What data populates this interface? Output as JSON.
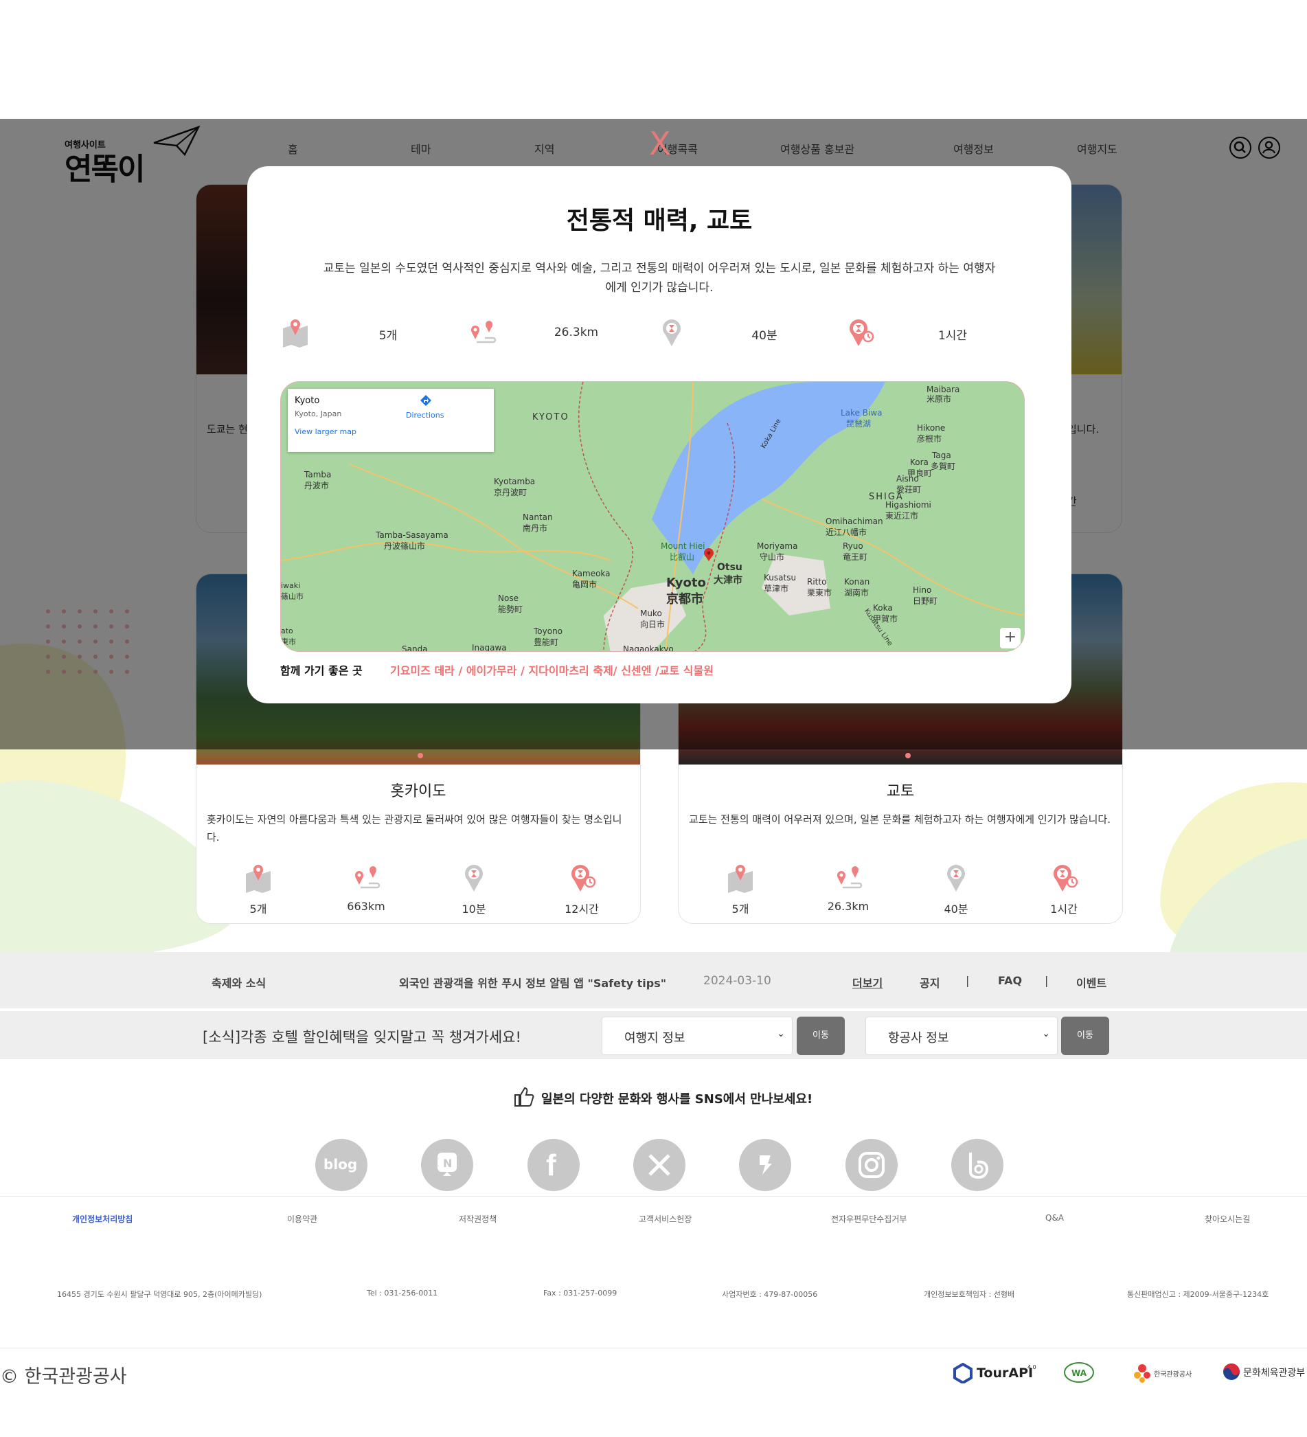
{
  "header": {
    "logo_small": "여행사이트",
    "logo_main": "연똑이",
    "nav": [
      "홈",
      "테마",
      "지역",
      "여행콕콕",
      "여행상품 홍보관",
      "여행정보",
      "여행지도"
    ]
  },
  "cards": {
    "tokyo_desc_fragment": "도쿄는 현",
    "osaka_desc_fragment": "입니다.",
    "osaka_time_fragment": "간",
    "hokkaido": {
      "title": "홋카이도",
      "desc": "홋카이도는 자연의 아름다움과 특색 있는 관광지로 둘러싸여 있어 많은 여행자들이 찾는 명소입니다.",
      "stats": [
        "5개",
        "663km",
        "10분",
        "12시간"
      ]
    },
    "kyoto": {
      "title": "교토",
      "desc": "교토는 전통의 매력이 어우러져 있으며, 일본 문화를 체험하고자 하는 여행자에게 인기가 많습니다.",
      "stats": [
        "5개",
        "26.3km",
        "40분",
        "1시간"
      ]
    }
  },
  "modal": {
    "close": "X",
    "title": "전통적 매력, 교토",
    "desc": "교토는 일본의 수도였던 역사적인 중심지로 역사와 예술, 그리고 전통의 매력이 어우러져 있는 도시로, 일본 문화를 체험하고자 하는 여행자에게 인기가 많습니다.",
    "stats": [
      "5개",
      "26.3km",
      "40분",
      "1시간"
    ],
    "map": {
      "place": "Kyoto",
      "place_sub": "Kyoto, Japan",
      "directions": "Directions",
      "larger": "View larger map",
      "labels": [
        "KYOTO",
        "Lake Biwa",
        "琵琶湖",
        "SHIGA",
        "Kyoto",
        "京都市",
        "Otsu",
        "大津市",
        "Mount Hiei",
        "比叡山",
        "Tamba",
        "丹波市",
        "Kyotamba",
        "京丹波町",
        "Nantan",
        "南丹市",
        "Tamba-Sasayama",
        "丹波篠山市",
        "Kameoka",
        "亀岡市",
        "Nose",
        "能勢町",
        "Muko",
        "向日市",
        "Toyono",
        "豊能町",
        "Moriyama",
        "守山市",
        "Ryuo",
        "竜王町",
        "Omihachiman",
        "近江八幡市",
        "Higashiomi",
        "東近江市",
        "Kusatsu",
        "草津市",
        "Ritto",
        "栗東市",
        "Konan",
        "湖南市",
        "Koka",
        "甲賀市",
        "Hino",
        "日野町",
        "Aisho",
        "愛荘町",
        "Kora",
        "甲良町",
        "Taga",
        "多賀町",
        "Hikone",
        "彦根市",
        "Maibara",
        "米原市",
        "Sanda",
        "Inagawa",
        "Nagaokakyo",
        "Koka Line",
        "Kusatsu Line",
        "iwaki",
        "篠山市",
        "ato",
        "東市"
      ]
    },
    "nearby_label": "함께 가기 좋은 곳",
    "nearby_value": "기요미즈 데라 / 에이가무라 / 지다이마츠리 축제/ 신센엔 /교토 식물원"
  },
  "news": {
    "section": "축제와 소식",
    "headline": "외국인 관광객을 위한 푸시 정보 알림 앱 \"Safety tips\"",
    "date": "2024-03-10",
    "more": "더보기",
    "tabs": [
      "공지",
      "FAQ",
      "이벤트"
    ],
    "sep": "|"
  },
  "notice": {
    "text": "[소식]각종 호텔 할인혜택을 잊지말고 꼭 챙겨가세요!",
    "select1": "여행지 정보",
    "select2": "항공사 정보",
    "go": "이동"
  },
  "sns": {
    "title": "일본의 다양한 문화와 행사를 SNS에서 만나보세요!",
    "icons": [
      "blog-icon",
      "naver-post-icon",
      "facebook-icon",
      "x-icon",
      "kakao-story-icon",
      "instagram-icon",
      "band-icon"
    ]
  },
  "footer": {
    "links": [
      "개인정보처리방침",
      "이용약관",
      "저작권정책",
      "고객서비스헌장",
      "전자우편무단수집거부",
      "Q&A",
      "찾아오시는길"
    ],
    "info": [
      "16455 경기도 수원시 팔달구 덕영대로 905, 2층(아이메카빌딩)",
      "Tel : 031-256-0011",
      "Fax : 031-257-0099",
      "사업자번호 : 479-87-00056",
      "개인정보보호책임자 : 선형배",
      "통신판매업신고 : 제2009-서울중구-1234호"
    ],
    "copyright": "© 한국관광공사",
    "logos": [
      "TourAPI",
      "4.0",
      "한국관광공사",
      "문화체육관광부"
    ]
  },
  "colors": {
    "accent": "#f07070",
    "overlay": "rgba(0,0,0,0.5)",
    "pin": "#f08080",
    "gray": "#c8c8c8"
  }
}
